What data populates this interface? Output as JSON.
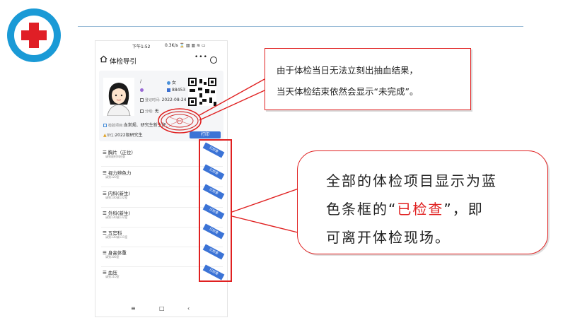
{
  "phone": {
    "status_time": "下午1:52",
    "status_right": "0.3K/s ⌛ ▥ ▥ ≋ ▭",
    "title": "体检导引",
    "nav_menu": "•••",
    "card": {
      "name_initial": "/",
      "gender": "女",
      "code": "88453",
      "date_label": "登记时间:",
      "date_value": "2022-08-24",
      "group_label": "分组:",
      "group_value": "无",
      "items_label": "检验项目:",
      "items_value": "血常规、研究生新生肝...",
      "unit_label": "单位:",
      "unit_value": "2022级研究生",
      "print_btn": "打印"
    },
    "items": [
      {
        "title": "胸片（正位）",
        "sub": "请到放射科检查",
        "badge": "已检查"
      },
      {
        "title": "视力辨色力",
        "sub": "请到120室",
        "badge": "已检查"
      },
      {
        "title": "内科(新生)",
        "sub": "请到130或132室",
        "badge": "已检查"
      },
      {
        "title": "外科(新生)",
        "sub": "请到130或132室",
        "badge": "已检查"
      },
      {
        "title": "五官科",
        "sub": "请到130或131室",
        "badge": "已检查"
      },
      {
        "title": "身高体重",
        "sub": "请到106室",
        "badge": "已检查"
      },
      {
        "title": "血压",
        "sub": "请到110室",
        "badge": "已检查"
      }
    ],
    "bottom_nav": [
      "≡",
      "□",
      "‹"
    ]
  },
  "callout1": {
    "line1": "由于体检当日无法立刻出抽血结果，",
    "line2": "当天体检结束依然会显示“未完成”。"
  },
  "callout2": {
    "line1": "全部的体检项目显示为蓝",
    "line2_pre": "色条框的“",
    "line2_highlight": "已检查",
    "line2_post": "”，即",
    "line3": "可离开体检现场。"
  },
  "colors": {
    "accent_red": "#e02020",
    "badge_blue": "#3b73d6",
    "logo_blue": "#1a9ad6"
  }
}
